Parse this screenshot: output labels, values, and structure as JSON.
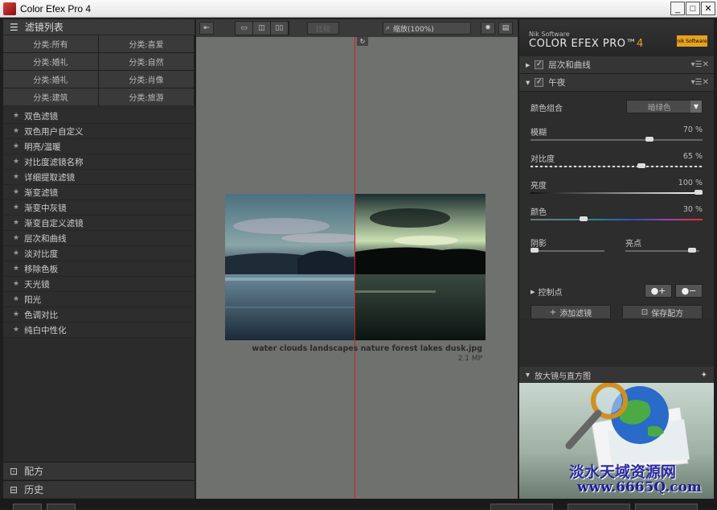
{
  "window": {
    "title": "Color Efex Pro 4"
  },
  "left": {
    "header": "滤镜列表",
    "categories": [
      "分类:所有",
      "分类:喜爱",
      "分类:婚礼",
      "分类:自然",
      "分类:婚礼",
      "分类:肖像",
      "分类:建筑",
      "分类:旅游"
    ],
    "filters": [
      "双色滤镜",
      "双色用户自定义",
      "明亮/温暖",
      "对比度滤镜名称",
      "详细提取滤镜",
      "渐变滤镜",
      "渐变中灰镜",
      "渐变自定义滤镜",
      "层次和曲线",
      "淡对比度",
      "移除色板",
      "天光镜",
      "阳光",
      "色调对比",
      "纯白中性化"
    ],
    "footer_recipes": "配方",
    "footer_history": "历史"
  },
  "toolbar": {
    "compare_label": "比较",
    "zoom_label": "缩放(100%)"
  },
  "preview": {
    "filename": "water clouds landscapes nature forest lakes dusk.jpg",
    "megapixels": "2.1 MP"
  },
  "right": {
    "brand_small": "Nik Software",
    "brand_name": "COLOR EFEX PRO™",
    "brand_version": "4",
    "logo_text": "nik Software",
    "section1": "层次和曲线",
    "section2": "午夜",
    "params": {
      "color_set_label": "颜色组合",
      "color_set_value": "暗绿色",
      "blur_label": "模糊",
      "blur_value": "70",
      "contrast_label": "对比度",
      "contrast_value": "65",
      "brightness_label": "亮度",
      "brightness_value": "100",
      "color_label": "颜色",
      "color_value": "30",
      "shadows_label": "阴影",
      "highlights_label": "亮点",
      "percent": "%",
      "blur_level": 0.7,
      "contrast_level": 0.65,
      "brightness_level": 1.0,
      "color_level": 0.3,
      "shadows_level": 0.0,
      "highlights_level": 0.95
    },
    "control_points_label": "控制点",
    "add_filter": "添加滤镜",
    "save_recipe": "保存配方",
    "loupe_label": "放大镜与直方图",
    "watermark1": "淡水天域资源网",
    "watermark2": "www.6665Q.com"
  }
}
